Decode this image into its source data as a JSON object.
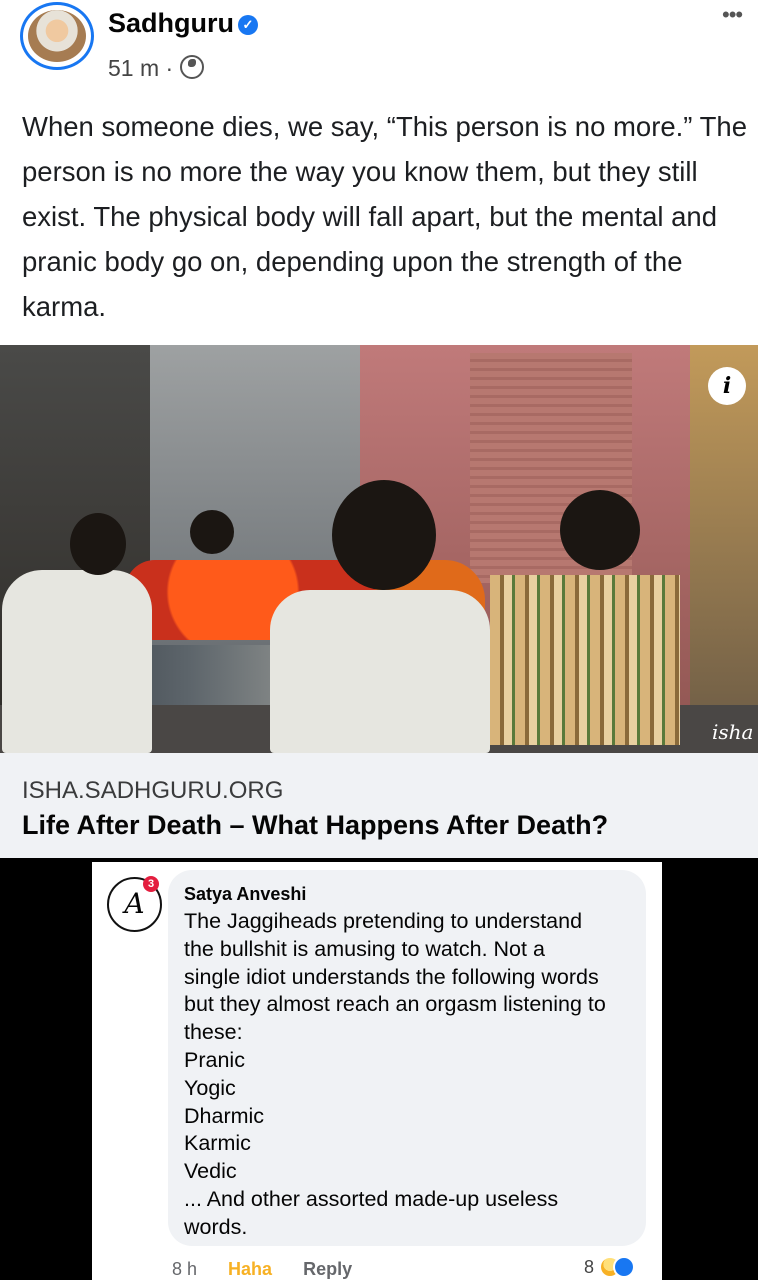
{
  "post": {
    "author": "Sadhguru",
    "time": "51 m",
    "separator": "·",
    "more_label": "•••",
    "text": "When someone dies, we say, “This person is no more.” The person is no more the way you know them, but they still exist. The physical body will fall apart, but the mental and pranic body go on, depending upon the strength of the karma.",
    "info_label": "i",
    "watermark": "isha"
  },
  "link": {
    "domain": "ISHA.SADHGURU.ORG",
    "title": "Life After Death – What Happens After Death?"
  },
  "comment": {
    "avatar_initials": "A",
    "avatar_badge": "3",
    "author": "Satya Anveshi",
    "lines": [
      "The Jaggiheads pretending to understand",
      "the bullshit is amusing to watch.  Not a",
      "single idiot understands the following words",
      "but they almost reach an orgasm listening to",
      "these:",
      "Pranic",
      "Yogic",
      "Dharmic",
      "Karmic",
      "Vedic",
      "... And other assorted made-up useless",
      "words."
    ],
    "time": "8 h",
    "reaction_label": "Haha",
    "reply_label": "Reply",
    "reaction_count": "8"
  },
  "colors": {
    "accent": "#1877f2",
    "haha": "#f7b125",
    "link_bg": "#f0f2f5"
  },
  "icons": [
    "verified-icon",
    "globe-icon",
    "more-icon",
    "info-icon",
    "haha-reaction-icon",
    "like-reaction-icon"
  ]
}
